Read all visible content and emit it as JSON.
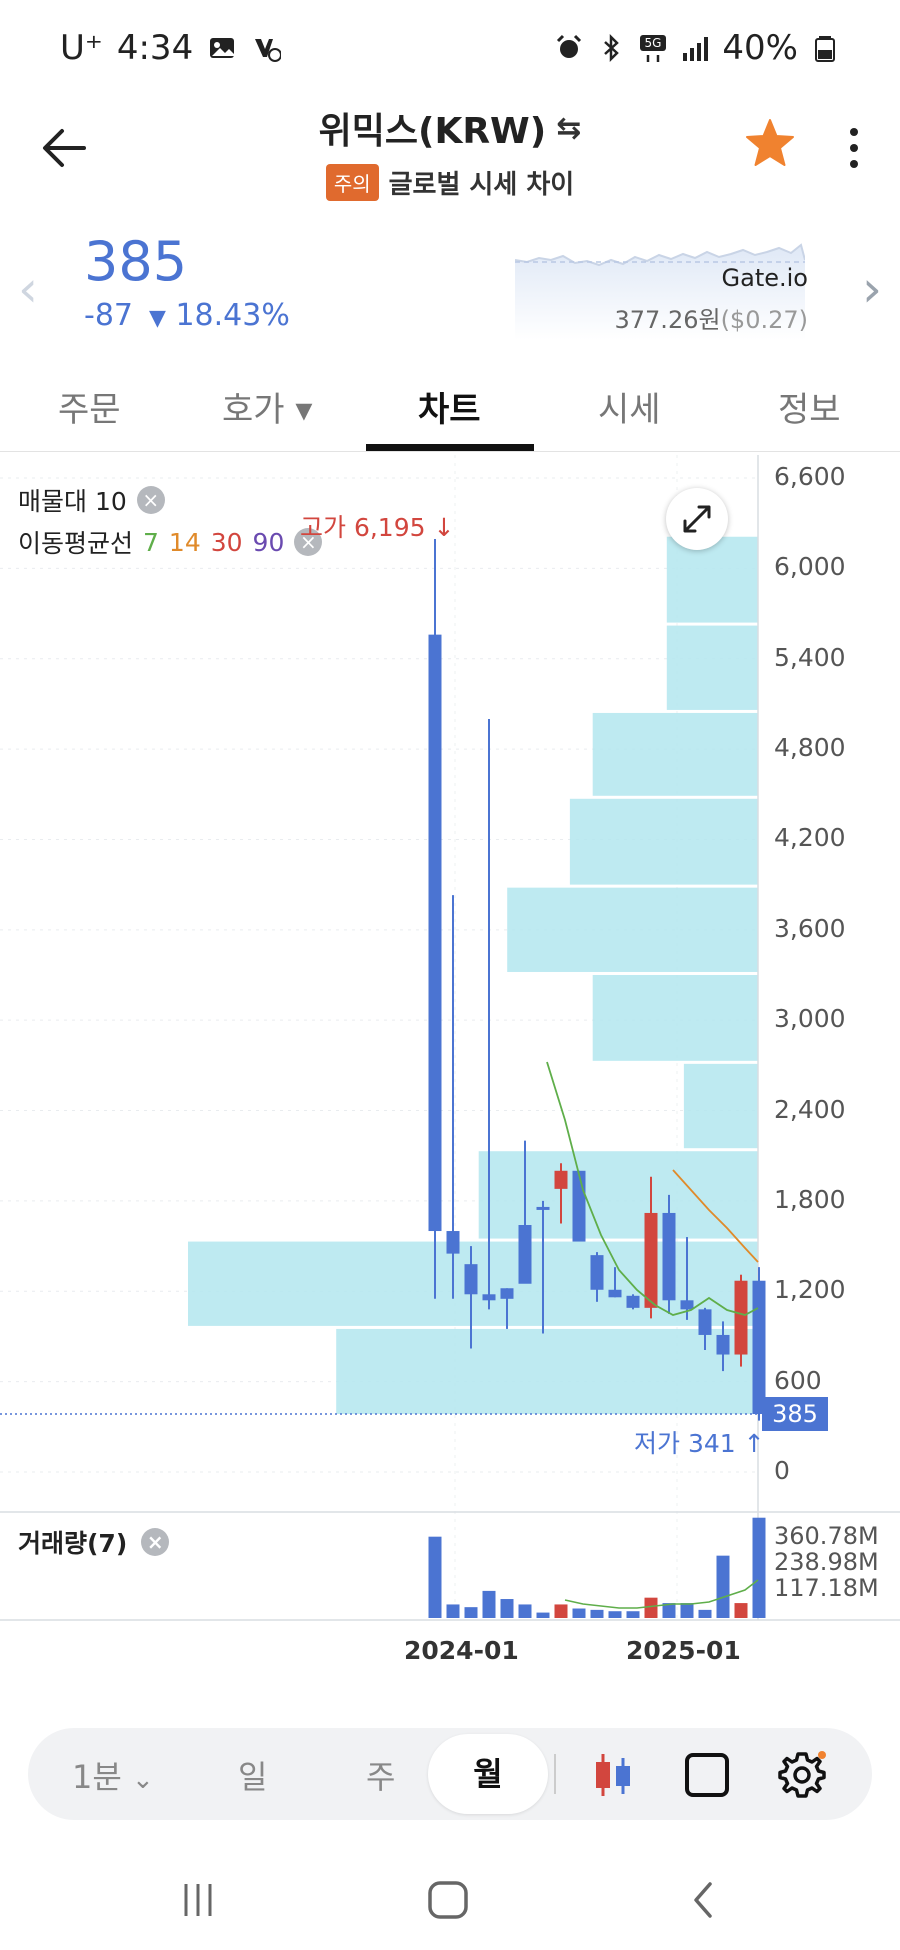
{
  "status_bar": {
    "carrier": "U⁺",
    "time": "4:34",
    "battery": "40%"
  },
  "header": {
    "title": "위믹스(KRW)",
    "swap_icon": "⇆",
    "warning_badge": "주의",
    "subtitle": "글로벌 시세 차이",
    "favorite_color": "#f0822f"
  },
  "price_summary": {
    "price": "385",
    "change": "-87",
    "change_rate": "18.43%",
    "exchange": "Gate.io",
    "exchange_price": "377.26원",
    "exchange_usd": "($0.27)"
  },
  "tabs": [
    {
      "label": "주문"
    },
    {
      "label": "호가 ▾"
    },
    {
      "label": "차트"
    },
    {
      "label": "시세"
    },
    {
      "label": "정보"
    }
  ],
  "active_tab": "차트",
  "indicators": {
    "volume_profile": "매물대 10",
    "moving_average_label": "이동평균선",
    "ma_periods": [
      "7",
      "14",
      "30",
      "90"
    ],
    "volume_label": "거래량(7)"
  },
  "chart_data": {
    "type": "candlestick",
    "interval": "monthly",
    "x_ticks": [
      "2024-01",
      "2025-01"
    ],
    "y_ticks": [
      "6,600",
      "6,000",
      "5,400",
      "4,800",
      "4,200",
      "3,600",
      "3,000",
      "2,400",
      "1,800",
      "1,200",
      "600",
      "0"
    ],
    "ylim": [
      0,
      6600
    ],
    "high_annotation": "고가 6,195",
    "low_annotation": "저가 341",
    "current_price_tag": "385",
    "candles": [
      {
        "open": 1600,
        "high": 6195,
        "low": 1150,
        "close": 5560,
        "color": "blue"
      },
      {
        "open": 1600,
        "high": 3830,
        "low": 1150,
        "close": 1450,
        "color": "blue"
      },
      {
        "open": 1380,
        "high": 1500,
        "low": 820,
        "close": 1180,
        "color": "blue"
      },
      {
        "open": 1180,
        "high": 5000,
        "low": 1080,
        "close": 1140,
        "color": "blue"
      },
      {
        "open": 1150,
        "high": 1220,
        "low": 950,
        "close": 1220,
        "color": "blue"
      },
      {
        "open": 1640,
        "high": 2200,
        "low": 1330,
        "close": 1250,
        "color": "blue"
      },
      {
        "open": 1760,
        "high": 1800,
        "low": 920,
        "close": 1760,
        "color": "blue"
      },
      {
        "open": 2000,
        "high": 2050,
        "low": 1650,
        "close": 1880,
        "color": "red"
      },
      {
        "open": 2000,
        "high": 2000,
        "low": 1740,
        "close": 1530,
        "color": "blue"
      },
      {
        "open": 1440,
        "high": 1460,
        "low": 1130,
        "close": 1210,
        "color": "blue"
      },
      {
        "open": 1210,
        "high": 1360,
        "low": 1160,
        "close": 1160,
        "color": "blue"
      },
      {
        "open": 1170,
        "high": 1180,
        "low": 1080,
        "close": 1090,
        "color": "blue"
      },
      {
        "open": 1090,
        "high": 1960,
        "low": 1020,
        "close": 1720,
        "color": "red"
      },
      {
        "open": 1720,
        "high": 1840,
        "low": 1050,
        "close": 1140,
        "color": "blue"
      },
      {
        "open": 1140,
        "high": 1560,
        "low": 1010,
        "close": 1080,
        "color": "blue"
      },
      {
        "open": 1080,
        "high": 1090,
        "low": 810,
        "close": 910,
        "color": "blue"
      },
      {
        "open": 910,
        "high": 1000,
        "low": 670,
        "close": 780,
        "color": "blue"
      },
      {
        "open": 780,
        "high": 1310,
        "low": 700,
        "close": 1270,
        "color": "red"
      },
      {
        "open": 1270,
        "high": 1360,
        "low": 341,
        "close": 385,
        "color": "blue"
      }
    ],
    "volume_profile": [
      {
        "from": 5640,
        "to": 6210,
        "width": 0.16
      },
      {
        "from": 5060,
        "to": 5620,
        "width": 0.16
      },
      {
        "from": 4490,
        "to": 5040,
        "width": 0.29
      },
      {
        "from": 3900,
        "to": 4470,
        "width": 0.33
      },
      {
        "from": 3320,
        "to": 3880,
        "width": 0.44
      },
      {
        "from": 2730,
        "to": 3300,
        "width": 0.29
      },
      {
        "from": 2150,
        "to": 2710,
        "width": 0.13
      },
      {
        "from": 1550,
        "to": 2130,
        "width": 0.49
      },
      {
        "from": 970,
        "to": 1530,
        "width": 1.0
      },
      {
        "from": 385,
        "to": 950,
        "width": 0.74
      }
    ],
    "volume_ticks": [
      "360.78M",
      "238.98M",
      "117.18M"
    ],
    "volume_bars": [
      {
        "value": 300,
        "color": "blue"
      },
      {
        "value": 50,
        "color": "blue"
      },
      {
        "value": 40,
        "color": "blue"
      },
      {
        "value": 100,
        "color": "blue"
      },
      {
        "value": 70,
        "color": "blue"
      },
      {
        "value": 50,
        "color": "blue"
      },
      {
        "value": 20,
        "color": "blue"
      },
      {
        "value": 50,
        "color": "red"
      },
      {
        "value": 35,
        "color": "blue"
      },
      {
        "value": 30,
        "color": "blue"
      },
      {
        "value": 25,
        "color": "blue"
      },
      {
        "value": 25,
        "color": "blue"
      },
      {
        "value": 75,
        "color": "red"
      },
      {
        "value": 55,
        "color": "blue"
      },
      {
        "value": 55,
        "color": "blue"
      },
      {
        "value": 30,
        "color": "blue"
      },
      {
        "value": 230,
        "color": "blue"
      },
      {
        "value": 55,
        "color": "red"
      },
      {
        "value": 370,
        "color": "blue"
      }
    ],
    "colors": {
      "up": "#d2463e",
      "down": "#4b74d2",
      "profile": "#b3e6ee",
      "ma7": "#5fae4a",
      "ma14": "#e08a2a"
    }
  },
  "interval_bar": {
    "minute": "1분",
    "day": "일",
    "week": "주",
    "month": "월"
  }
}
